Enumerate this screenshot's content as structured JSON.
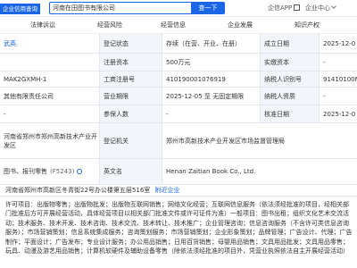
{
  "header": {
    "brand": "企业信用查询",
    "search_value": "河南在田图书有限公司",
    "search_button": "查一下",
    "app_link": "企信APP",
    "center_link": "企业中心"
  },
  "tabs": [
    "法律诉讼",
    "经营风险",
    "经营信息",
    "企业发展",
    "知识产权"
  ],
  "rows": {
    "r1": {
      "value_left": "武英",
      "label_a": "登记状态",
      "value_a": "存续（在营、开业、在册）",
      "label_b": "成立日期",
      "value_b": "2025-12-0"
    },
    "r2": {
      "label_a": "注册资本",
      "value_a": "500万元",
      "label_b": "实缴资本",
      "value_b": "-"
    },
    "r3": {
      "value_left": "MAK2GXMH-1",
      "label_a": "工商注册号",
      "value_a": "410190001076919",
      "label_b": "纳税人识别号",
      "value_b": "91410100M"
    },
    "r4": {
      "value_left": "其他有限责任公司",
      "label_a": "营业期限",
      "value_a": "2025-12-05 至 无固定期限",
      "label_b": "纳税人资质",
      "value_b": "-"
    },
    "r5": {
      "value_left": "-",
      "label_a": "参保人数",
      "value_a": "-",
      "label_b": "核准日期",
      "value_b": "2025-12-0"
    },
    "r6": {
      "value_left": "河南省郑州市郑州高新技术产业开发区",
      "label_a": "登记机关",
      "value_a": "郑州市高新技术产业开发区市场监督管理局"
    },
    "r7": {
      "value_left": "图书、报刊零售",
      "value_left_count": "(F5243)",
      "label_a": "英文名",
      "value_a": "Henan Zaitian Book Co., Ltd."
    }
  },
  "address": {
    "text": "河南省郑州市高新区冬青街22号办公楼第五层516室",
    "aux": "附近企业"
  },
  "scope": {
    "text": "许可项目：出版物零售；出版物批发；出版物互联网销售；网络文化经营；互联网信息服务（依法须经批准的项目，经相关部门批准后方可开展经营活动，具体经营项目以相关部门批准文件或许可证件为准）一般项目：图书出租；组织文化艺术交流活动；技术服务、技术开发、技术咨询、技术交流、技术转让、技术推广；企业管理咨询；信息咨询服务（不含许可类信息咨询服务）；市场营销策划；信息系统集成服务；咨询策划服务；市场营销策划；企业形象策划；品牌管理；广告设计、代理；广告制作；平面设计；广告发布；专业设计服务；办公用品销售；日用百货销售；母婴用品销售；文具用品批发；文具用品零售；玩具、动漫及游艺用品销售；计算机软硬件及辅助设备零售（除依法须经批准的项目外，凭营业执照依法自主开展经营活动）"
  },
  "colors": {
    "accent": "#1a66e6",
    "label_bg": "#f2f6fb",
    "border": "#e3e8f0"
  }
}
